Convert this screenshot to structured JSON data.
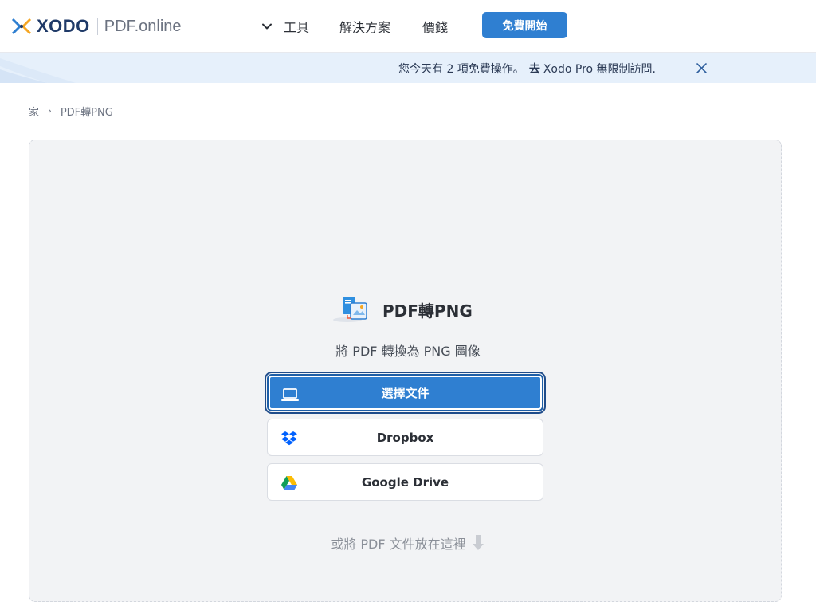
{
  "header": {
    "logo_word": "XODO",
    "logo_product": "PDF.online",
    "nav": {
      "tools_label": "工具",
      "solutions_label": "解決方案",
      "pricing_label": "價錢"
    },
    "start_button_label": "免費開始"
  },
  "banner": {
    "message": "您今天有 2 項免費操作。",
    "cta_go": "去",
    "cta_rest": "Xodo Pro 無限制訪問."
  },
  "breadcrumb": {
    "home": "家",
    "separator": "›",
    "current": "PDF轉PNG"
  },
  "tool": {
    "name": "PDF轉PNG",
    "subtitle": "將 PDF 轉換為 PNG 圖像"
  },
  "actions": {
    "choose_file_label": "選擇文件",
    "dropbox_label": "Dropbox",
    "gdrive_label": "Google Drive"
  },
  "drop_hint": "或將 PDF 文件放在這裡",
  "colors": {
    "accent": "#2f7fd1",
    "banner_bg": "#e6f0fb",
    "dropzone_bg": "#f2f3f5"
  },
  "icons": {
    "logo": "xodo-logo-icon",
    "tools_chevron": "chevron-down-icon",
    "banner_close": "close-icon",
    "tool": "pdf-to-image-icon",
    "choose_file": "laptop-icon",
    "dropbox": "dropbox-icon",
    "gdrive": "google-drive-icon",
    "drop_arrow": "arrow-down-icon"
  }
}
